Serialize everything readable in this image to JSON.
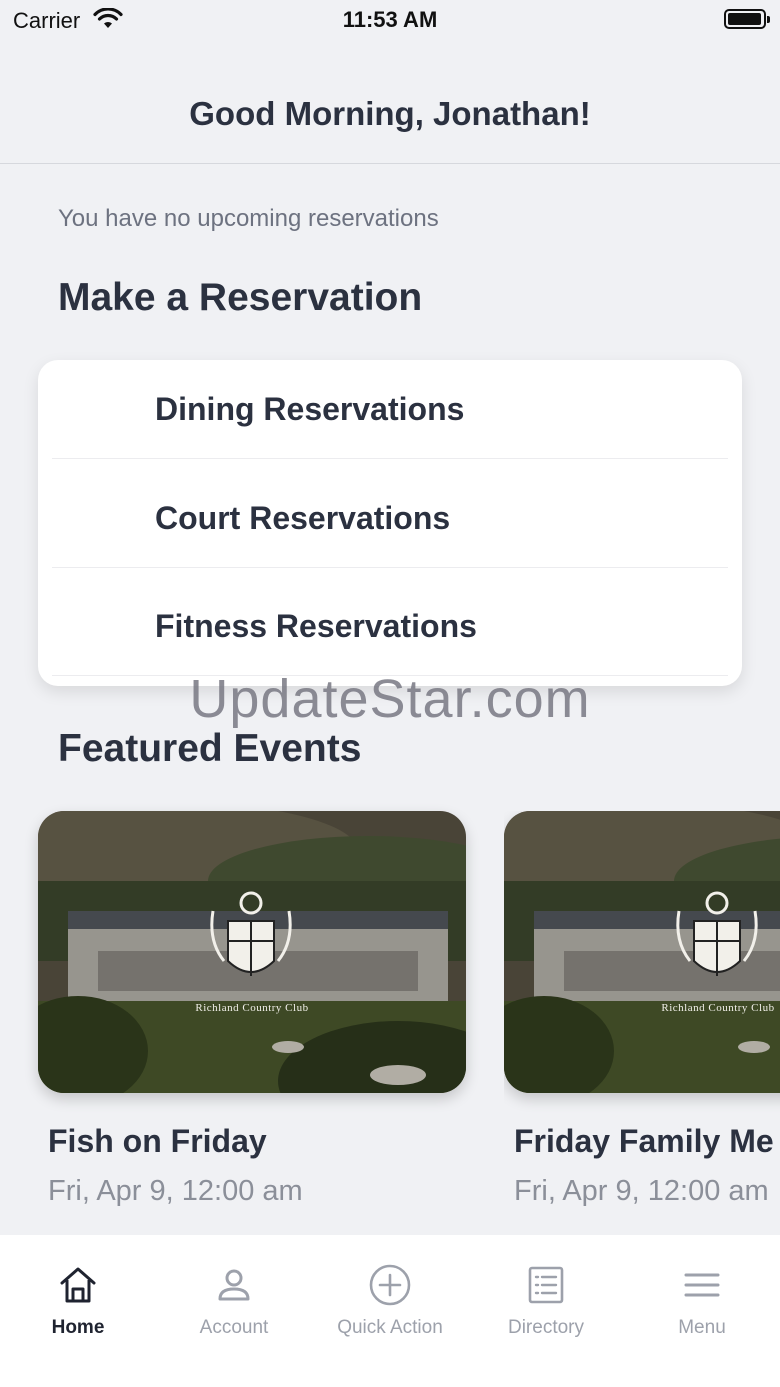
{
  "status_bar": {
    "carrier": "Carrier",
    "time": "11:53 AM"
  },
  "header": {
    "greeting": "Good Morning, Jonathan!"
  },
  "reservations": {
    "empty_message": "You have no upcoming reservations",
    "section_title": "Make a Reservation",
    "items": [
      {
        "label": "Dining Reservations"
      },
      {
        "label": "Court Reservations"
      },
      {
        "label": "Fitness Reservations"
      }
    ]
  },
  "watermark": "UpdateStar.com",
  "events": {
    "section_title": "Featured Events",
    "items": [
      {
        "title": "Fish on Friday",
        "date": "Fri, Apr 9, 12:00 am",
        "logo_text": "Richland Country Club"
      },
      {
        "title": "Friday Family Me",
        "date": "Fri, Apr 9, 12:00 am",
        "logo_text": "Richland Country Club"
      }
    ]
  },
  "tab_bar": {
    "active": "Home",
    "tabs": [
      {
        "label": "Home",
        "icon": "home-icon"
      },
      {
        "label": "Account",
        "icon": "person-icon"
      },
      {
        "label": "Quick Action",
        "icon": "plus-circle-icon"
      },
      {
        "label": "Directory",
        "icon": "list-document-icon"
      },
      {
        "label": "Menu",
        "icon": "hamburger-icon"
      }
    ]
  },
  "colors": {
    "text_primary": "#2b3140",
    "text_secondary": "#8b8f99",
    "background": "#f0f1f4",
    "tab_inactive": "#9da1ab"
  }
}
